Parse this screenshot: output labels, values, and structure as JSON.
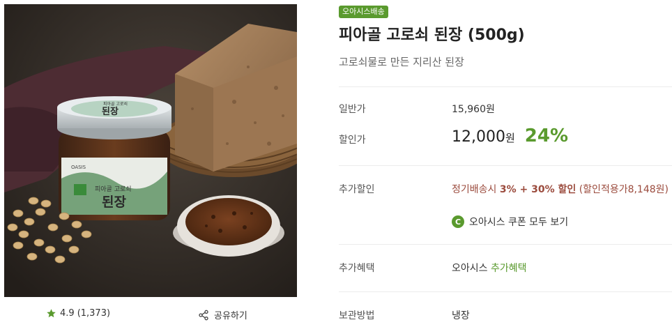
{
  "product": {
    "badge": "오아시스배송",
    "title": "피아골 고로쇠 된장 (500g)",
    "subtitle": "고로쇠물로 만든 지리산 된장",
    "jar_lid_label": "된장",
    "jar_lid_top": "피아골 고로쇠",
    "jar_body_brand": "OASIS",
    "jar_body_top": "피아골 고로쇠",
    "jar_body_main": "된장"
  },
  "rating": {
    "score": "4.9",
    "count": "(1,373)"
  },
  "share": {
    "label": "공유하기"
  },
  "price": {
    "regular_label": "일반가",
    "regular_value": "15,960원",
    "sale_label": "할인가",
    "sale_value": "12,000",
    "sale_unit": "원",
    "discount_rate": "24%"
  },
  "extra_discount": {
    "label": "추가할인",
    "prefix": "정기배송시 ",
    "highlight": "3% + 30% 할인",
    "suffix": " (할인적용가8,148원)",
    "coupon_icon_letter": "C",
    "coupon_link": "오아시스 쿠폰 모두 보기"
  },
  "extra_benefit": {
    "label": "추가혜택",
    "prefix": "오아시스 ",
    "highlight": "추가혜택"
  },
  "storage": {
    "label": "보관방법",
    "value": "냉장"
  },
  "colors": {
    "accent": "#5a9a2e",
    "discount_text": "#9b4b3d"
  }
}
